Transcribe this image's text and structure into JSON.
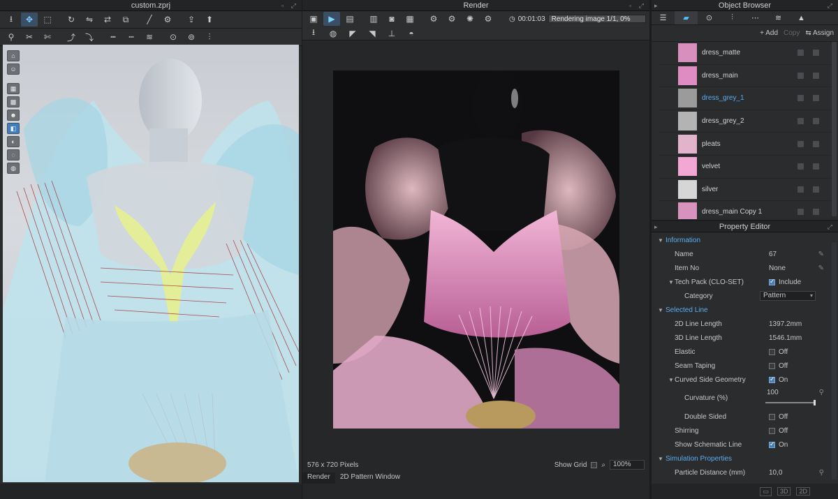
{
  "left_window": {
    "title": "custom.zprj",
    "toolbar_row1": [
      "download-icon",
      "move-icon",
      "select-box-icon",
      "sep",
      "rotate-icon",
      "flip-icon",
      "mirror-icon",
      "copy-icon",
      "sep",
      "line-tool-icon",
      "gear-icon",
      "sep",
      "export-icon",
      "upload-icon"
    ],
    "toolbar_row2": [
      "pin-icon",
      "sewing-icon",
      "sewing2-icon",
      "sep",
      "fold-icon",
      "fold2-icon",
      "sep",
      "stitch-icon",
      "stitch2-icon",
      "puckering-icon",
      "sep",
      "button-icon",
      "buttonhole-icon",
      "zipper-icon"
    ],
    "view_tools": [
      "view-home-icon",
      "view-avatar-icon",
      "sep",
      "texture-icon",
      "mesh-icon",
      "avatar-icon",
      "render-mode-icon",
      "shadow-icon",
      "xray-icon",
      "globe-icon"
    ]
  },
  "render_window": {
    "title": "Render",
    "time": "00:01:03",
    "status": "Rendering image 1/1, 0%",
    "progress": 0,
    "image_size": "576 x 720 Pixels",
    "show_grid_label": "Show Grid",
    "zoom": "100%",
    "tabs": [
      "Render",
      "2D Pattern Window"
    ],
    "active_tab": 0
  },
  "object_browser": {
    "title": "Object Browser",
    "tabs": [
      "list-icon",
      "fabric-icon",
      "button-icon",
      "zipper-icon",
      "topstitch-icon",
      "puckering-icon",
      "graphic-icon"
    ],
    "active_tab": 1,
    "add_label": "Add",
    "copy_label": "Copy",
    "assign_label": "Assign",
    "materials": [
      {
        "name": "dress_matte",
        "color": "#d88fbd",
        "selected": false
      },
      {
        "name": "dress_main",
        "color": "#de8cc2",
        "selected": false
      },
      {
        "name": "dress_grey_1",
        "color": "#9b9b9b",
        "selected": true
      },
      {
        "name": "dress_grey_2",
        "color": "#b3b3b3",
        "selected": false
      },
      {
        "name": "pleats",
        "color": "#e2b4cc",
        "selected": false
      },
      {
        "name": "velvet",
        "color": "#f3a8d3",
        "selected": false
      },
      {
        "name": "silver",
        "color": "#d6d6d6",
        "selected": false
      },
      {
        "name": "dress_main Copy 1",
        "color": "#d792be",
        "selected": false
      }
    ]
  },
  "property_editor": {
    "title": "Property Editor",
    "information_label": "Information",
    "name_label": "Name",
    "name_value": "67",
    "item_no_label": "Item No",
    "item_no_value": "None",
    "tech_pack_label": "Tech Pack (CLO-SET)",
    "include_label": "Include",
    "category_label": "Category",
    "category_value": "Pattern",
    "selected_line_label": "Selected Line",
    "line_2d_label": "2D Line Length",
    "line_2d_value": "1397.2mm",
    "line_3d_label": "3D Line Length",
    "line_3d_value": "1546.1mm",
    "elastic_label": "Elastic",
    "elastic_value": "Off",
    "seam_taping_label": "Seam Taping",
    "seam_taping_value": "Off",
    "curved_side_label": "Curved Side Geometry",
    "curved_side_value": "On",
    "curvature_label": "Curvature (%)",
    "curvature_value": "100",
    "double_sided_label": "Double Sided",
    "double_sided_value": "Off",
    "shirring_label": "Shirring",
    "shirring_value": "Off",
    "schematic_label": "Show Schematic Line",
    "schematic_value": "On",
    "simulation_label": "Simulation Properties",
    "particle_label": "Particle Distance (mm)",
    "particle_value": "10,0"
  },
  "bottom_bar": {
    "labels": [
      "3D",
      "2D"
    ]
  }
}
